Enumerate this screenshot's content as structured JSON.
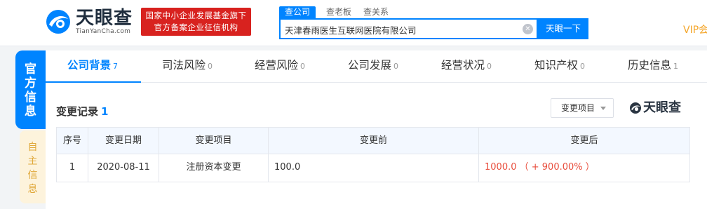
{
  "header": {
    "logo_text": "天眼查",
    "logo_url": "TianYanCha.com",
    "badge_line1": "国家中小企业发展基金旗下",
    "badge_line2": "官方备案企业征信机构",
    "search_tabs": [
      "查公司",
      "查老板",
      "查关系"
    ],
    "search_value": "天津春雨医生互联网医院有限公司",
    "clear_symbol": "✕",
    "search_button": "天眼一下",
    "vip_label": "VIP会"
  },
  "side": {
    "official": [
      "官",
      "方",
      "信",
      "息"
    ],
    "self": [
      "自",
      "主",
      "信",
      "息"
    ]
  },
  "tabs": [
    {
      "label": "公司背景",
      "count": "7"
    },
    {
      "label": "司法风险",
      "count": "0"
    },
    {
      "label": "经营风险",
      "count": "0"
    },
    {
      "label": "公司发展",
      "count": "0"
    },
    {
      "label": "经营状况",
      "count": "0"
    },
    {
      "label": "知识产权",
      "count": "0"
    },
    {
      "label": "历史信息",
      "count": "1"
    }
  ],
  "section": {
    "title": "变更记录",
    "count": "1",
    "filter_label": "变更项目",
    "brand": "天眼查"
  },
  "table": {
    "columns": [
      "序号",
      "变更日期",
      "变更项目",
      "变更前",
      "变更后"
    ],
    "rows": [
      {
        "index": "1",
        "date": "2020-08-11",
        "item": "注册资本变更",
        "before": "100.0",
        "after": "1000.0 （ + 900.00% ）"
      }
    ]
  },
  "colors": {
    "accent": "#0084ff",
    "badge_red": "#d8221f",
    "vip_gold": "#f4a62a",
    "increase_red": "#e84d3c"
  }
}
